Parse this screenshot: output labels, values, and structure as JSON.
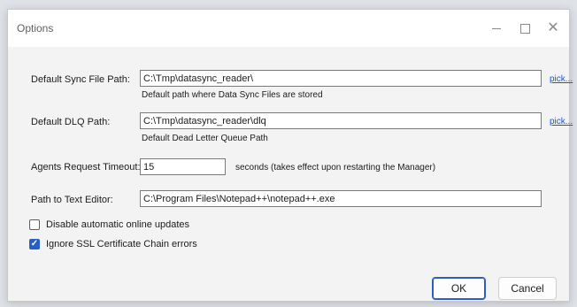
{
  "window": {
    "title": "Options"
  },
  "icons": {
    "minimize": "minimize-icon",
    "maximize": "maximize-icon",
    "close": "close-icon",
    "check": "checkmark-icon"
  },
  "sync_path": {
    "label": "Default Sync File Path:",
    "value": "C:\\Tmp\\datasync_reader\\",
    "hint": "Default path where Data Sync Files are stored",
    "pick": "pick..."
  },
  "dlq_path": {
    "label": "Default DLQ Path:",
    "value": "C:\\Tmp\\datasync_reader\\dlq",
    "hint": "Default Dead Letter Queue Path",
    "pick": "pick..."
  },
  "timeout": {
    "label": "Agents Request Timeout:",
    "value": "15",
    "suffix": "seconds (takes effect upon restarting the Manager)"
  },
  "editor": {
    "label": "Path to Text Editor:",
    "value": "C:\\Program Files\\Notepad++\\notepad++.exe"
  },
  "options": {
    "disable_updates": {
      "label": "Disable automatic online updates",
      "checked": false
    },
    "ignore_ssl": {
      "label": "Ignore SSL Certificate Chain errors",
      "checked": true
    }
  },
  "buttons": {
    "ok": "OK",
    "cancel": "Cancel"
  },
  "colors": {
    "accent": "#2560c9",
    "link": "#1a56d6",
    "titlebar": "#ffffff",
    "body": "#f3f3f3"
  }
}
